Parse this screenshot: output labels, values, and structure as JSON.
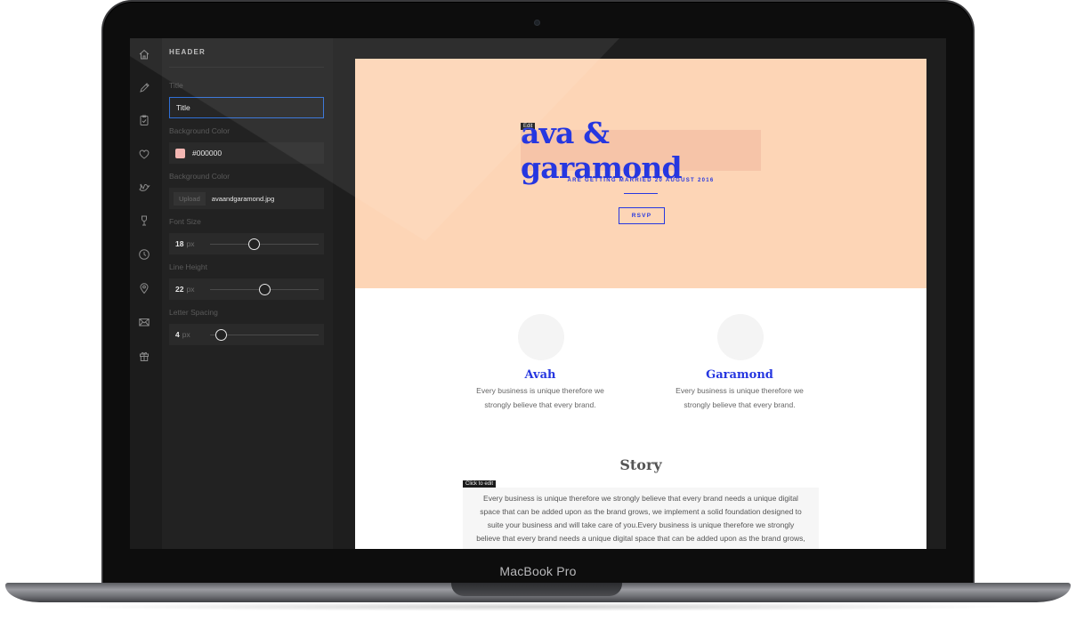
{
  "device": {
    "label": "MacBook Pro"
  },
  "sidebar": {
    "icons": [
      "home-icon",
      "pencil-icon",
      "clipboard-icon",
      "heart-icon",
      "dove-icon",
      "wine-glass-icon",
      "clock-icon",
      "location-pin-icon",
      "envelope-icon",
      "gift-icon"
    ]
  },
  "editor": {
    "heading": "HEADER",
    "title_label": "Title",
    "title_value": "Title",
    "bg_color_label": "Background Color",
    "bg_color_value": "#000000",
    "bg_image_label": "Background Color",
    "upload_label": "Upload",
    "bg_image_file": "avaandgaramond.jpg",
    "font_size_label": "Font Size",
    "font_size_value": "18",
    "line_height_label": "Line Height",
    "line_height_value": "22",
    "letter_spacing_label": "Letter Spacing",
    "letter_spacing_value": "4",
    "unit": "px",
    "swatch_color": "#f3b6b2",
    "slider_levels": {
      "font_size": 0.4,
      "line_height": 0.5,
      "letter_spacing": 0.1
    }
  },
  "site": {
    "edit_tag": "Edit",
    "hero_title": "ava & garamond",
    "tagline": "ARE GETTING MARRIED 20 AUGUST 2016",
    "rsvp": "RSVP",
    "couple": [
      {
        "name": "Avah",
        "desc_line1": "Every business is unique therefore we",
        "desc_line2": "strongly believe that every brand."
      },
      {
        "name": "Garamond",
        "desc_line1": "Every business is unique therefore we",
        "desc_line2": "strongly believe that every brand."
      }
    ],
    "story_title": "Story",
    "click_tag": "Click to edit",
    "story_lines": [
      "Every business is unique therefore we strongly believe that every brand needs a unique digital",
      "space that can be added upon as the brand grows, we implement a solid foundation designed to",
      "suite your business and will take care of you.Every business is unique therefore we strongly",
      "believe that every brand needs a unique digital space that can be added upon as the brand grows,"
    ],
    "colors": {
      "accent": "#2637e0",
      "hero_bg": "#fdd5b6"
    }
  }
}
